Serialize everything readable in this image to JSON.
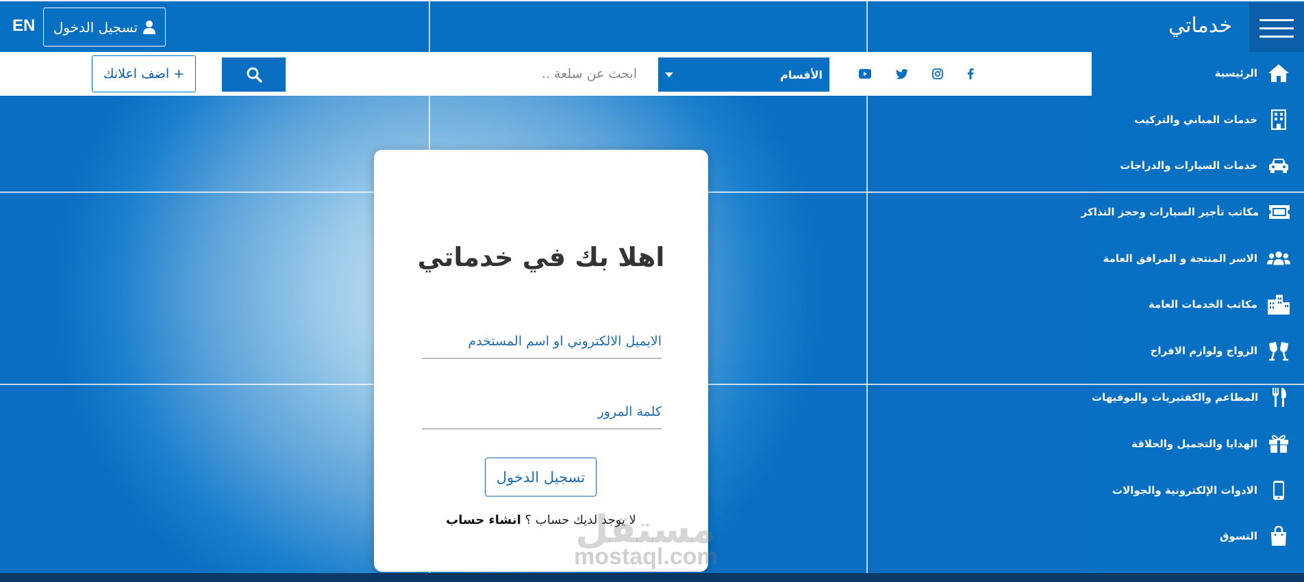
{
  "header": {
    "brand": "خدماتي",
    "lang_label": "EN",
    "login_label": "تسجيل الدخول"
  },
  "searchbar": {
    "add_ad_label": "+ اضف اعلانك",
    "search_placeholder": "ابحث عن سلعة ..",
    "category_label": "الأقسام",
    "social": [
      "facebook-icon",
      "instagram-icon",
      "twitter-icon",
      "youtube-icon"
    ]
  },
  "sidebar": {
    "items": [
      {
        "label": "الرئيسية",
        "icon": "home-icon"
      },
      {
        "label": "خدمات المباني والتركيب",
        "icon": "building-icon"
      },
      {
        "label": "خدمات السيارات والدراجات",
        "icon": "car-icon"
      },
      {
        "label": "مكاتب تأجير السيارات وحجز التذاكر",
        "icon": "ticket-icon"
      },
      {
        "label": "الاسر المنتجة و المرافق العامة",
        "icon": "users-icon"
      },
      {
        "label": "مكاتب الخدمات العامة",
        "icon": "city-icon"
      },
      {
        "label": "الزواج ولوازم الافراح",
        "icon": "glasses-icon"
      },
      {
        "label": "المطاعم والكفتيريات والبوفيهات",
        "icon": "utensils-icon"
      },
      {
        "label": "الهدايا والتجميل والحلاقة",
        "icon": "gift-icon"
      },
      {
        "label": "الادوات الإلكترونية والجوالات",
        "icon": "mobile-icon"
      },
      {
        "label": "التسوق",
        "icon": "shopping-bag-icon"
      }
    ]
  },
  "login_card": {
    "title": "اهلا بك في خدماتي",
    "email_placeholder": "الايميل الالكتروني او اسم المستخدم",
    "password_placeholder": "كلمة المرور",
    "submit_label": "تسجيل الدخول",
    "no_account_text": "لا يوجد لديك حساب ؟",
    "signup_link": "انشاء حساب"
  },
  "watermark": {
    "arabic": "مستقل",
    "latin": "mostaql.com"
  },
  "colors": {
    "primary": "#0870c2",
    "dark": "#0a5fa8",
    "link": "#1f6bb0"
  }
}
